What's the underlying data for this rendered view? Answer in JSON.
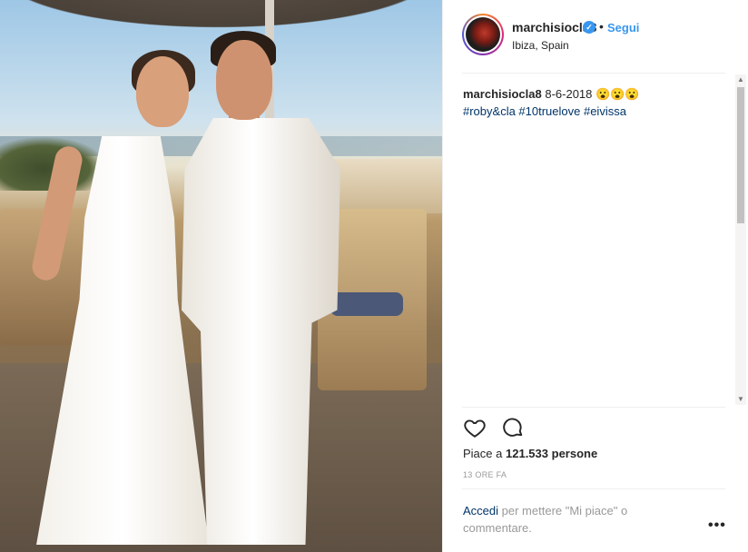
{
  "post": {
    "username": "marchisiocla8",
    "verified_badge": "✓",
    "separator": "•",
    "follow_label": "Segui",
    "location": "Ibiza, Spain",
    "caption": {
      "username": "marchisiocla8",
      "text": "8-6-2018 😮😮😮",
      "hashtags": "#roby&cla #10truelove #eivissa"
    },
    "likes_prefix": "Piace a",
    "likes_count": "121.533",
    "likes_suffix": "persone",
    "timestamp": "13 ORE FA",
    "login_link": "Accedi",
    "login_text": "per mettere \"Mi piace\" o commentare.",
    "more_label": "•••"
  },
  "icons": {
    "like": "heart-icon",
    "comment": "comment-icon",
    "verified": "verified-badge-icon",
    "scroll_up": "▲",
    "scroll_down": "▼"
  },
  "colors": {
    "accent_link": "#3897f0",
    "text": "#262626",
    "muted": "#999999",
    "hashtag": "#003569"
  }
}
